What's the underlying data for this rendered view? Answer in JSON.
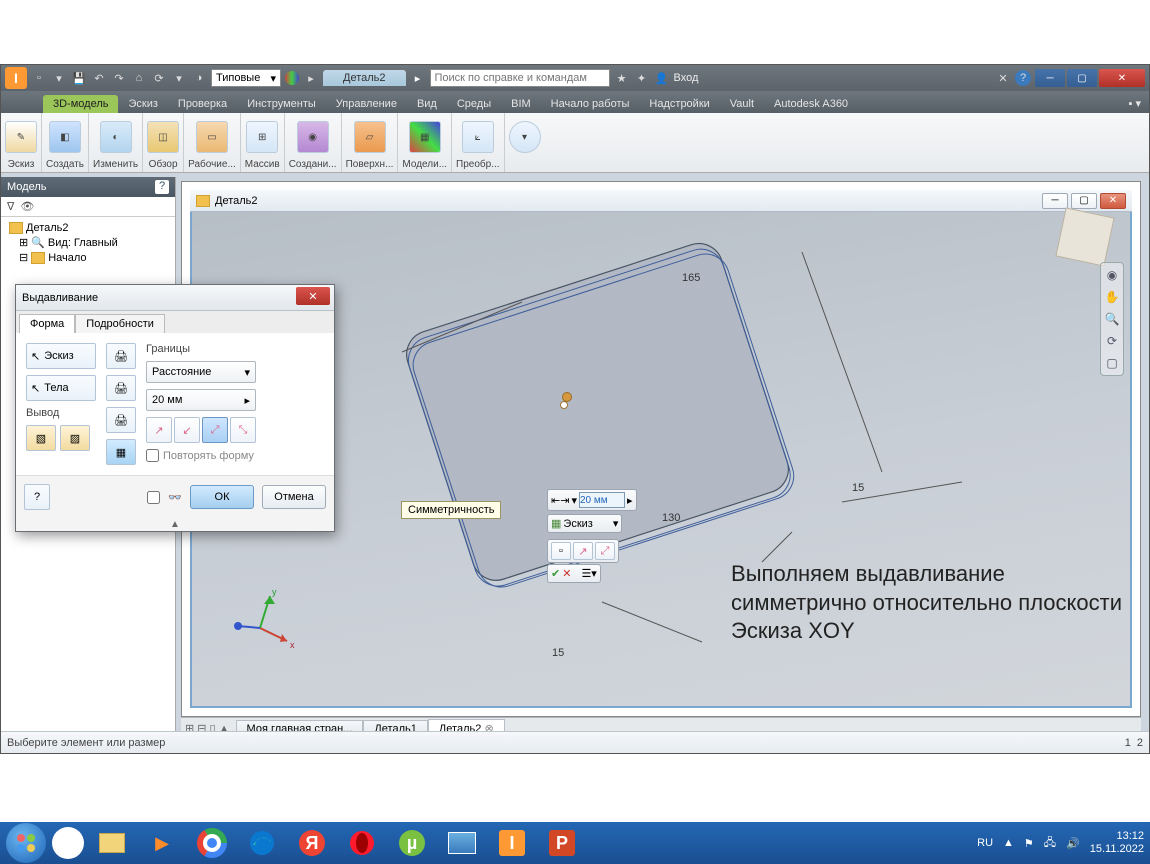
{
  "qat": {
    "combo": "Типовые",
    "doc_tab": "Деталь2",
    "search_placeholder": "Поиск по справке и командам",
    "login": "Вход"
  },
  "tabs": [
    "3D-модель",
    "Эскиз",
    "Проверка",
    "Инструменты",
    "Управление",
    "Вид",
    "Среды",
    "BIM",
    "Начало работы",
    "Надстройки",
    "Vault",
    "Autodesk A360"
  ],
  "ribbon": [
    "Эскиз",
    "Создать",
    "Изменить",
    "Обзор",
    "Рабочие...",
    "Массив",
    "Создани...",
    "Поверхн...",
    "Модели...",
    "Преобр..."
  ],
  "browser": {
    "title": "Модель",
    "root": "Деталь2",
    "view": "Вид: Главный",
    "start": "Начало"
  },
  "viewport": {
    "title": "Деталь2",
    "dims": {
      "d165": "165",
      "d15a": "15",
      "d130": "130",
      "d15b": "15"
    },
    "annotation": "Выполняем выдавливание\n симметрично относительно плоскости\nЭскиза XOY"
  },
  "minitool": {
    "dist": "20 мм",
    "profile": "Эскиз"
  },
  "dialog": {
    "title": "Выдавливание",
    "tabs": [
      "Форма",
      "Подробности"
    ],
    "profile": "Эскиз",
    "solids": "Тела",
    "output": "Вывод",
    "extents": "Границы",
    "extents_mode": "Расстояние",
    "distance": "20 мм",
    "tooltip": "Симметричность",
    "repeat": "Повторять форму",
    "ok": "ОК",
    "cancel": "Отмена"
  },
  "doctabs": {
    "home": "Моя главная стран...",
    "d1": "Деталь1",
    "d2": "Деталь2"
  },
  "status": {
    "msg": "Выберите элемент или размер",
    "p1": "1",
    "p2": "2"
  },
  "taskbar": {
    "lang": "RU",
    "time": "13:12",
    "date": "15.11.2022"
  }
}
